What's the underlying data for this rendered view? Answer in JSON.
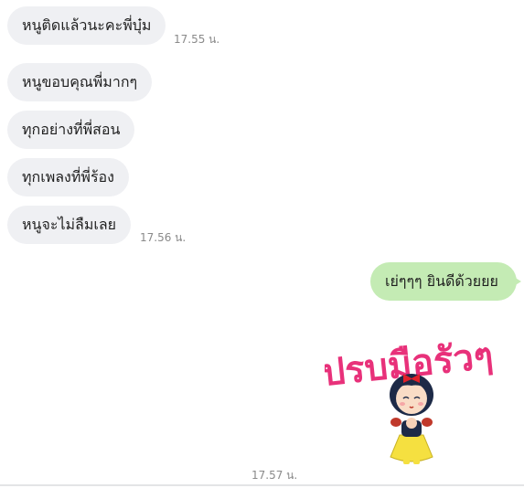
{
  "messages": [
    {
      "side": "in",
      "text": "หนูติดแล้วนะคะพี่บุ๋ม"
    },
    {
      "side": "in",
      "text": "หนูขอบคุณพี่มากๆ"
    },
    {
      "side": "in",
      "text": "ทุกอย่างที่พี่สอน"
    },
    {
      "side": "in",
      "text": "ทุกเพลงที่พี่ร้อง"
    },
    {
      "side": "in",
      "text": "หนูจะไม่ลืมเลย"
    },
    {
      "side": "out",
      "text": "เย่ๆๆๆ ยินดีด้วยยย"
    }
  ],
  "times": {
    "t1": "17.55 น.",
    "t2": "17.56 น.",
    "t3": "17.57 น."
  },
  "sticker": {
    "text": "ปรบมือรัวๆ",
    "icon": "snow-white-clapping-sticker",
    "colors": {
      "text": "#e8317a",
      "dress": "#f5e040",
      "hair": "#1d2a47",
      "bow": "#e0212a"
    }
  },
  "colors": {
    "incoming_bubble": "#eff0f3",
    "outgoing_bubble": "#c4ebb4",
    "timestamp": "#8a8a8a"
  }
}
